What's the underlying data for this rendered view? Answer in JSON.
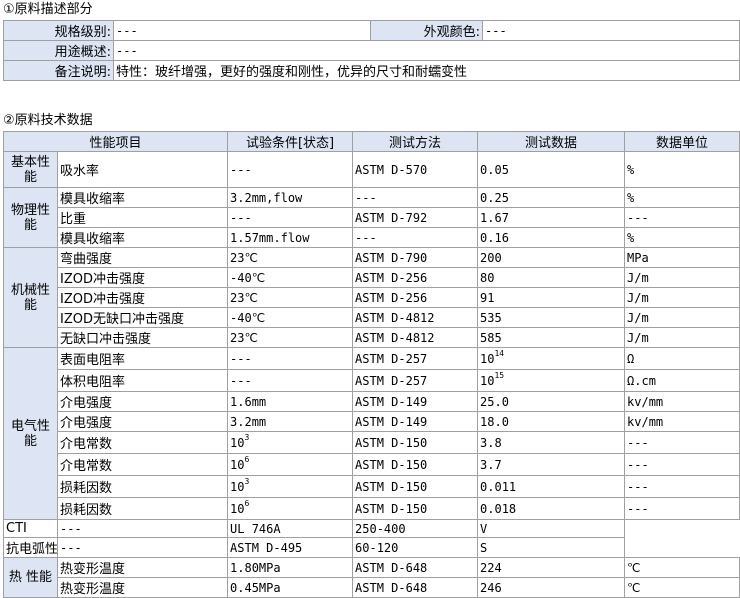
{
  "section1": {
    "title": "①原料描述部分",
    "grade_label": "规格级别:",
    "grade_value": "---",
    "color_label": "外观颜色:",
    "color_value": "---",
    "usage_label": "用途概述:",
    "usage_value": "---",
    "notes_label": "备注说明:",
    "notes_value": "特性：玻纤增强，更好的强度和刚性，优异的尺寸和耐蠕变性"
  },
  "section2": {
    "title": "②原料技术数据",
    "headers": [
      "性能项目",
      "试验条件[状态]",
      "测试方法",
      "测试数据",
      "数据单位"
    ],
    "groups": [
      "基本性能",
      "物理性能",
      "机械性能",
      "电气性能",
      "热 性能"
    ],
    "rows": [
      {
        "name": "吸水率",
        "cond": "---",
        "method": "ASTM D-570",
        "val": "0.05",
        "sup": "",
        "unit": "%"
      },
      {
        "name": "模具收缩率",
        "cond": "3.2mm,flow",
        "method": "---",
        "val": "0.25",
        "sup": "",
        "unit": "%"
      },
      {
        "name": "比重",
        "cond": "---",
        "method": "ASTM D-792",
        "val": "1.67",
        "sup": "",
        "unit": "---"
      },
      {
        "name": "模具收缩率",
        "cond": "1.57mm.flow",
        "method": "---",
        "val": "0.16",
        "sup": "",
        "unit": "%"
      },
      {
        "name": "弯曲强度",
        "cond": "23℃",
        "method": "ASTM D-790",
        "val": "200",
        "sup": "",
        "unit": "MPa"
      },
      {
        "name": "IZOD冲击强度",
        "cond": "-40℃",
        "method": "ASTM D-256",
        "val": "80",
        "sup": "",
        "unit": "J/m"
      },
      {
        "name": "IZOD冲击强度",
        "cond": "23℃",
        "method": "ASTM D-256",
        "val": "91",
        "sup": "",
        "unit": "J/m"
      },
      {
        "name": "IZOD无缺口冲击强度",
        "cond": "-40℃",
        "method": "ASTM D-4812",
        "val": "535",
        "sup": "",
        "unit": "J/m"
      },
      {
        "name": "无缺口冲击强度",
        "cond": "23℃",
        "method": "ASTM D-4812",
        "val": "585",
        "sup": "",
        "unit": "J/m"
      },
      {
        "name": "表面电阻率",
        "cond": "---",
        "method": "ASTM D-257",
        "val": "10",
        "sup": "14",
        "unit": "Ω"
      },
      {
        "name": "体积电阻率",
        "cond": "---",
        "method": "ASTM D-257",
        "val": "10",
        "sup": "15",
        "unit": "Ω.cm"
      },
      {
        "name": "介电强度",
        "cond": "1.6mm",
        "method": "ASTM D-149",
        "val": "25.0",
        "sup": "",
        "unit": "kv/mm"
      },
      {
        "name": "介电强度",
        "cond": "3.2mm",
        "method": "ASTM D-149",
        "val": "18.0",
        "sup": "",
        "unit": "kv/mm"
      },
      {
        "name": "介电常数",
        "cond": "10",
        "csup": "3",
        "method": "ASTM D-150",
        "val": "3.8",
        "sup": "",
        "unit": "---"
      },
      {
        "name": "介电常数",
        "cond": "10",
        "csup": "6",
        "method": "ASTM D-150",
        "val": "3.7",
        "sup": "",
        "unit": "---"
      },
      {
        "name": "损耗因数",
        "cond": "10",
        "csup": "3",
        "method": "ASTM D-150",
        "val": "0.011",
        "sup": "",
        "unit": "---"
      },
      {
        "name": "损耗因数",
        "cond": "10",
        "csup": "6",
        "method": "ASTM D-150",
        "val": "0.018",
        "sup": "",
        "unit": "---"
      },
      {
        "name": "CTI",
        "cond": "---",
        "method": "UL 746A",
        "val": "250-400",
        "sup": "",
        "unit": "V"
      },
      {
        "name": "抗电弧性",
        "cond": "---",
        "method": "ASTM D-495",
        "val": "60-120",
        "sup": "",
        "unit": "S"
      },
      {
        "name": "热变形温度",
        "cond": "1.80MPa",
        "method": "ASTM D-648",
        "val": "224",
        "sup": "",
        "unit": "℃"
      },
      {
        "name": "热变形温度",
        "cond": "0.45MPa",
        "method": "ASTM D-648",
        "val": "246",
        "sup": "",
        "unit": "℃"
      }
    ]
  }
}
